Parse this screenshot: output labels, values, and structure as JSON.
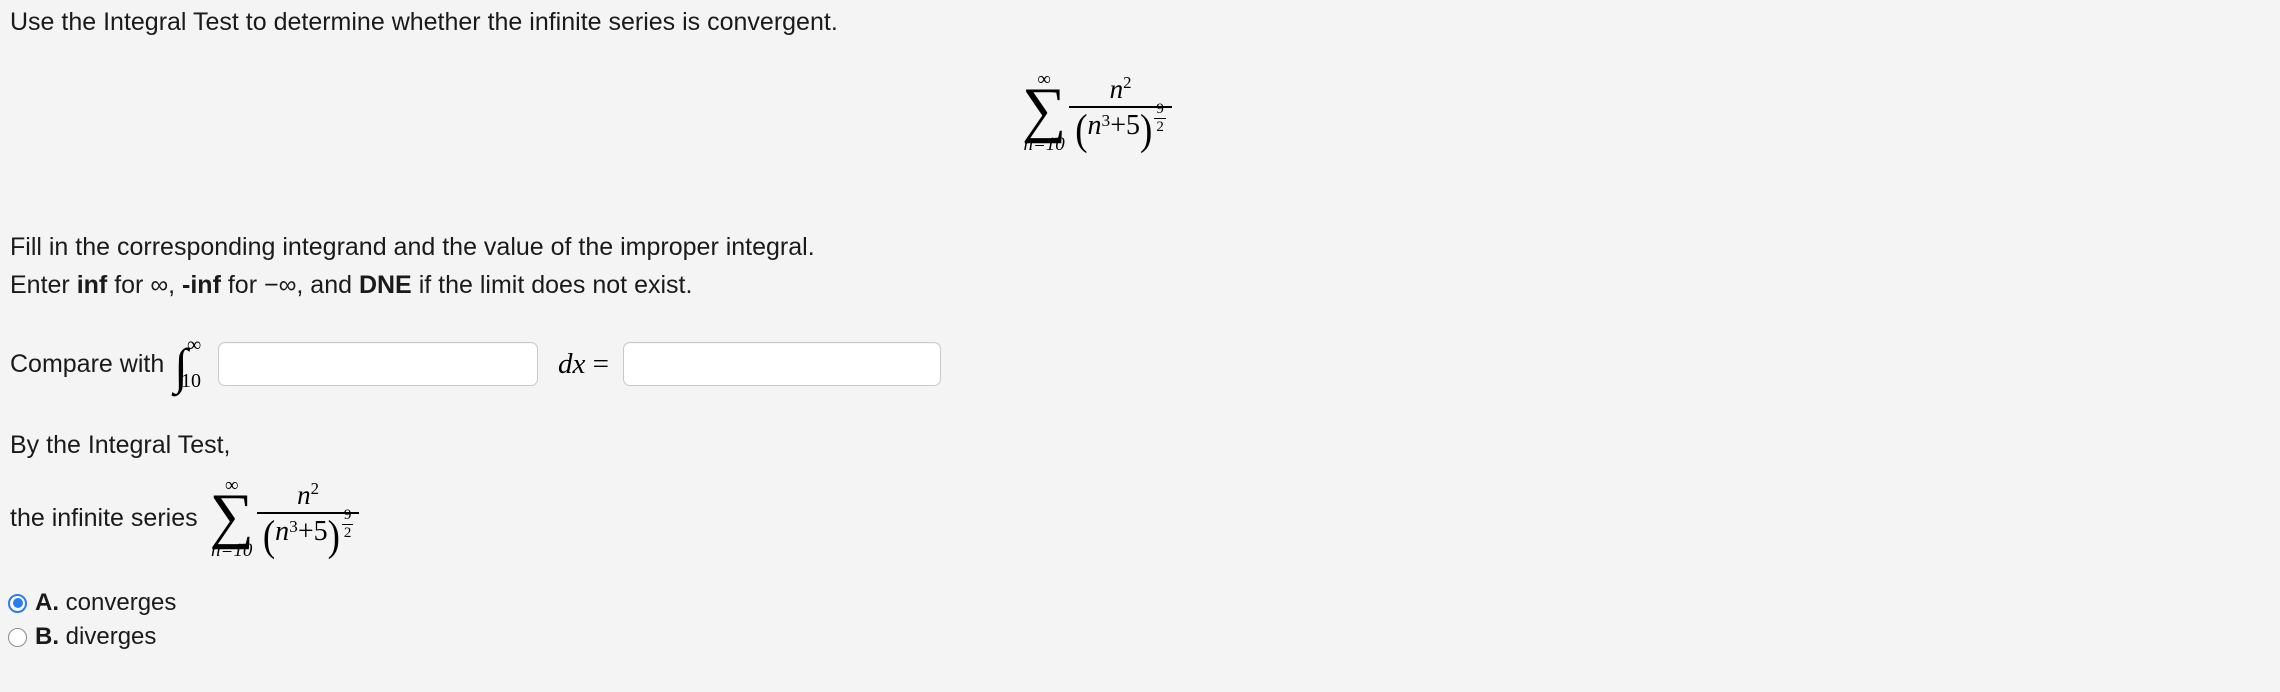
{
  "background_color": "#f4f4f4",
  "text_color": "#1a1a1a",
  "accent_color": "#2b7cf0",
  "instructions": {
    "intro": "Use the Integral Test to determine whether the infinite series is convergent.",
    "fill_in": "Fill in the corresponding integrand and the value of the improper integral.",
    "enter_prefix": "Enter ",
    "enter_inf": "inf",
    "enter_for_infinity": " for ∞, ",
    "enter_neg_inf": "-inf",
    "enter_for_neg_infinity": " for −∞, and ",
    "enter_dne": "DNE",
    "enter_suffix": " if the limit does not exist.",
    "by_test": "By the Integral Test,"
  },
  "series": {
    "operator": "∑",
    "upper_limit": "∞",
    "lower_limit": "n=10",
    "numerator_base": "n",
    "numerator_exponent": "2",
    "denominator_open_paren": "(",
    "denominator_base": "n",
    "denominator_base_exponent": "3",
    "denominator_plus": " + ",
    "denominator_constant": "5",
    "denominator_close_paren": ")",
    "denominator_power_numerator": "9",
    "denominator_power_denominator": "2",
    "plain_text": "sum from n=10 to infinity of n^2 / (n^3 + 5)^(9/2)"
  },
  "compare_row": {
    "label": "Compare with",
    "integral_symbol": "∫",
    "integral_upper": "∞",
    "integral_lower": "10",
    "integrand_value": "",
    "integrand_placeholder": "",
    "dx_variable": "dx",
    "equals": "=",
    "value_value": "",
    "value_placeholder": ""
  },
  "conclusion": {
    "label": "the infinite series",
    "options": [
      {
        "key": "A.",
        "text": "converges",
        "selected": true
      },
      {
        "key": "B.",
        "text": "diverges",
        "selected": false
      }
    ]
  }
}
